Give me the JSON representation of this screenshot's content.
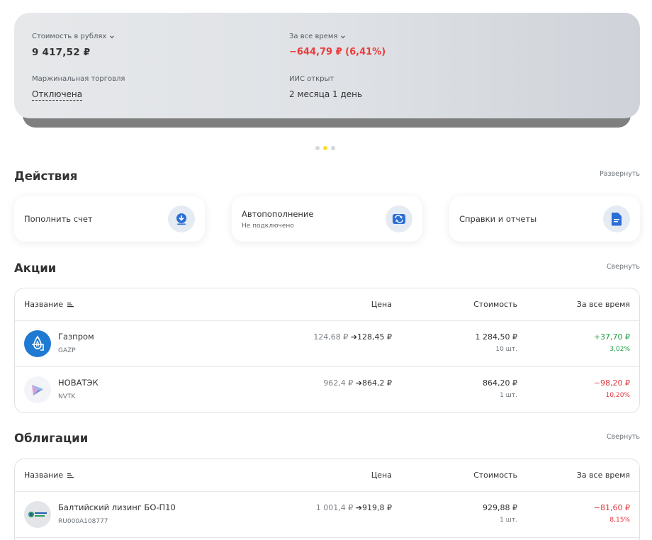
{
  "summary": {
    "value_label": "Стоимость в рублях",
    "value": "9 417,52 ₽",
    "period_label": "За все время",
    "period_value": "−644,79 ₽ (6,41%)",
    "margin_label": "Маржинальная торговля",
    "margin_value": "Отключена",
    "iis_label": "ИИС открыт",
    "iis_value": "2 месяца 1 день"
  },
  "carousel": {
    "active_index": 1,
    "count": 3
  },
  "actions": {
    "title": "Действия",
    "toggle": "Развернуть",
    "tiles": [
      {
        "label": "Пополнить счет",
        "sub": "",
        "icon": "download-icon"
      },
      {
        "label": "Автопополнение",
        "sub": "Не подключено",
        "icon": "repeat-icon"
      },
      {
        "label": "Справки и отчеты",
        "sub": "",
        "icon": "document-icon"
      }
    ]
  },
  "columns": {
    "name": "Название",
    "price": "Цена",
    "cost": "Стоимость",
    "alltime": "За все время"
  },
  "stocks": {
    "title": "Акции",
    "toggle": "Свернуть",
    "rows": [
      {
        "name": "Газпром",
        "ticker": "GAZP",
        "price_old": "124,68 ₽",
        "price_new": "128,45 ₽",
        "cost": "1 284,50 ₽",
        "qty": "10 шт.",
        "pl": "+37,70 ₽",
        "pl_pct": "3,02%",
        "positive": true
      },
      {
        "name": "НОВАТЭК",
        "ticker": "NVTK",
        "price_old": "962,4 ₽",
        "price_new": "864,2 ₽",
        "cost": "864,20 ₽",
        "qty": "1 шт.",
        "pl": "−98,20 ₽",
        "pl_pct": "10,20%",
        "positive": false
      }
    ]
  },
  "bonds": {
    "title": "Облигации",
    "toggle": "Свернуть",
    "rows": [
      {
        "name": "Балтийский лизинг БО-П10",
        "ticker": "RU000A108777",
        "price_old": "1 001,4 ₽",
        "price_new": "919,8 ₽",
        "cost": "929,88 ₽",
        "qty": "1 шт.",
        "pl": "−81,60 ₽",
        "pl_pct": "8,15%",
        "positive": false
      }
    ]
  },
  "colors": {
    "accent_yellow": "#ffdd2d",
    "negative": "#e0343a",
    "positive": "#1b9c3f",
    "icon_blue": "#2b6fd6"
  }
}
